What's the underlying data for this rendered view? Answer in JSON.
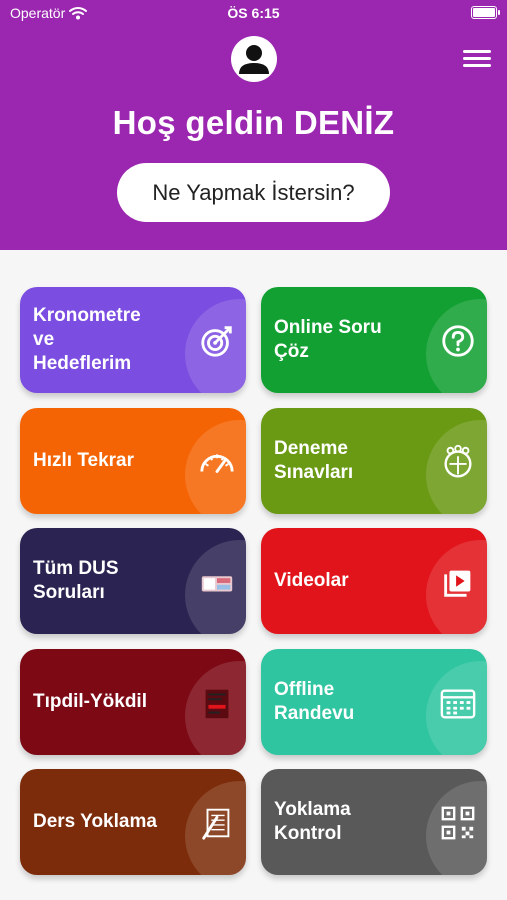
{
  "status_bar": {
    "carrier": "Operatör",
    "time": "ÖS 6:15"
  },
  "header": {
    "greeting": "Hoş geldin DENİZ",
    "cta_label": "Ne Yapmak İstersin?",
    "background": "#9b27b0"
  },
  "tiles": [
    {
      "label": "Kronometre\nve\nHedeflerim",
      "color": "#7b4de0",
      "icon": "target-icon"
    },
    {
      "label": "Online Soru\nÇöz",
      "color": "#12a032",
      "icon": "question-circle-icon"
    },
    {
      "label": "Hızlı Tekrar",
      "color": "#f56404",
      "icon": "speedometer-icon"
    },
    {
      "label": "Deneme\nSınavları",
      "color": "#6a9a14",
      "icon": "exam-group-icon"
    },
    {
      "label": "Tüm DUS\nSoruları",
      "color": "#2b2351",
      "icon": "question-books-icon"
    },
    {
      "label": "Videolar",
      "color": "#e0141a",
      "icon": "video-library-icon"
    },
    {
      "label": "Tıpdil-Yökdil",
      "color": "#7c0914",
      "icon": "exam-paper-icon"
    },
    {
      "label": "Offline\nRandevu",
      "color": "#2fc5a0",
      "icon": "calendar-icon"
    },
    {
      "label": "Ders Yoklama",
      "color": "#7c2c0a",
      "icon": "attendance-sheet-icon"
    },
    {
      "label": "Yoklama\nKontrol",
      "color": "#595959",
      "icon": "qr-code-icon"
    }
  ]
}
